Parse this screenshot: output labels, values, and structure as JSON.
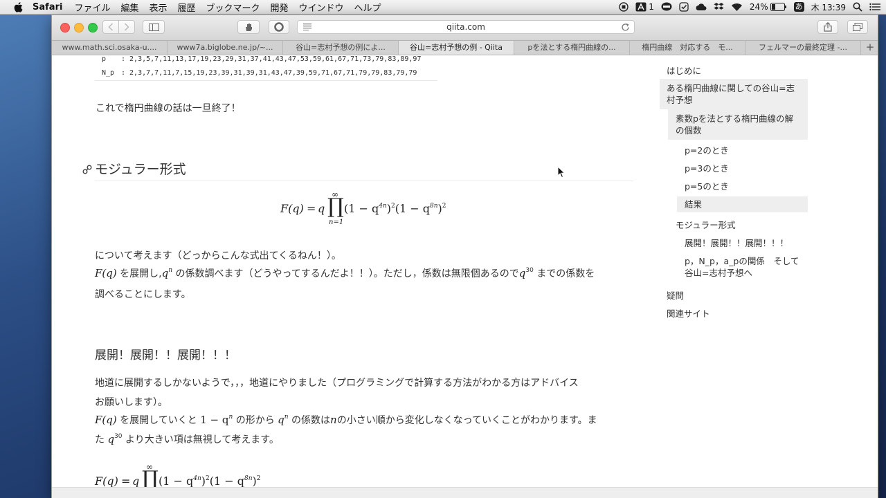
{
  "menubar": {
    "app": "Safari",
    "items": [
      "ファイル",
      "編集",
      "表示",
      "履歴",
      "ブックマーク",
      "開発",
      "ウインドウ",
      "ヘルプ"
    ]
  },
  "status": {
    "adobe_count": "1",
    "battery": "24%",
    "input_method": "あ",
    "clock": "木 13:39"
  },
  "browser": {
    "url_host": "qiita.com",
    "tabs": [
      "www.math.sci.osaka-u....",
      "www7a.biglobe.ne.jp/~...",
      "谷山=志村予想の例によ...",
      "谷山=志村予想の例 - Qiita",
      "pを法とする楕円曲線の...",
      "楕円曲線　対応する　モ...",
      "フェルマーの最終定理 -..."
    ],
    "active_tab": 3
  },
  "article": {
    "table": {
      "p_label": "p",
      "p_values": ": 2,3,5,7,11,13,17,19,23,29,31,37,41,43,47,53,59,61,67,71,73,79,83,89,97",
      "np_label": "N_p",
      "np_values": ": 2,3,7,7,11,7,15,19,23,39,31,39,31,43,47,39,59,71,67,71,79,79,83,79,79"
    },
    "end_text": "これで楕円曲線の話は一旦終了！",
    "modular_heading": "モジュラー形式",
    "para1": "について考えます（どっからこんな式出てくるねん！）。",
    "para2_a": "を展開し,",
    "para2_b": "の係数調べます（どうやってするんだよ！！）。ただし，係数は無限個あるので",
    "para2_c": "までの係数を",
    "para2_d": "調べることにします。",
    "expand_heading": "展開！展開！！展開！！！",
    "para3_a": "地道に展開するしかないようで，，，地道にやりました（プログラミングで計算する方法がわかる方はアドバイス",
    "para3_b": "お願いします）。",
    "para4_a": "を展開していくと",
    "para4_b": "の形から",
    "para4_c": "の係数は",
    "para4_d": "の小さい順から変化しなくなっていくことがわかります。ま",
    "para4_e": "た",
    "para4_f": "より大きい項は無視して考えます。"
  },
  "math": {
    "Fq": "F(q)",
    "eq_q": "q",
    "eq_factor1": "(1 − q",
    "eq_exp1": "4n",
    "eq_mid": ")",
    "eq_sq": "2",
    "eq_factor2": "(1 − q",
    "eq_exp2": "8n",
    "prod": "∏",
    "inf": "∞",
    "lower": "n=1",
    "q": "q",
    "n": "n",
    "exp30": "30",
    "one_minus": "1 − q"
  },
  "toc": [
    {
      "label": "はじめに"
    },
    {
      "label": "ある楕円曲線に関しての谷山=志村予想"
    },
    {
      "label": "素数pを法とする楕円曲線の解の個数"
    },
    {
      "label": "p=2のとき"
    },
    {
      "label": "p=3のとき"
    },
    {
      "label": "p=5のとき"
    },
    {
      "label": "結果"
    },
    {
      "label": "モジュラー形式"
    },
    {
      "label": "展開！展開！！展開！！！"
    },
    {
      "label": "p，N_p，a_pの関係　そして谷山=志村予想へ"
    },
    {
      "label": "疑問"
    },
    {
      "label": "関連サイト"
    }
  ],
  "colors": {
    "close": "#fc605c",
    "minimize": "#fdbc40",
    "zoom": "#34c84a"
  }
}
